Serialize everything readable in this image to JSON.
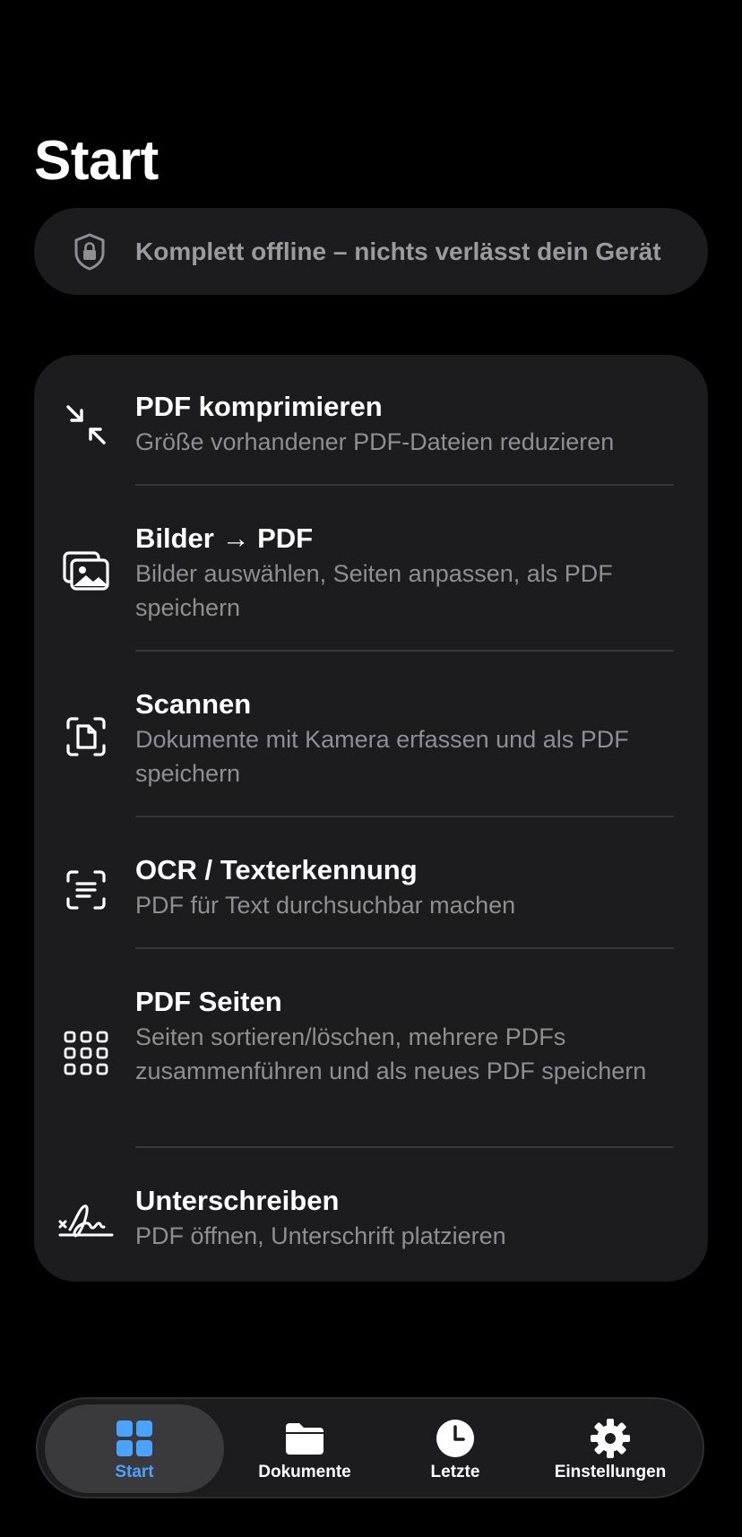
{
  "page": {
    "title": "Start"
  },
  "banner": {
    "icon": "shield-lock-icon",
    "text": "Komplett offline – nichts verlässt dein Gerät"
  },
  "tools": [
    {
      "icon": "compress-arrows-icon",
      "title": "PDF komprimieren",
      "subtitle": "Größe vorhandener PDF-Dateien reduzieren"
    },
    {
      "icon": "images-icon",
      "title": "Bilder → PDF",
      "subtitle": "Bilder auswählen, Seiten anpassen, als PDF speichern"
    },
    {
      "icon": "document-scan-icon",
      "title": "Scannen",
      "subtitle": "Dokumente mit Kamera erfassen und als PDF speichern"
    },
    {
      "icon": "text-recognition-icon",
      "title": "OCR / Texterkennung",
      "subtitle": "PDF für Text durchsuchbar machen"
    },
    {
      "icon": "grid-pages-icon",
      "title": "PDF Seiten",
      "subtitle": "Seiten sortieren/löschen, mehrere PDFs zusammenführen und als neues PDF speichern"
    },
    {
      "icon": "signature-icon",
      "title": "Unterschreiben",
      "subtitle": "PDF öffnen, Unterschrift platzieren"
    }
  ],
  "tabbar": {
    "active_color": "#4aa3ff",
    "tabs": [
      {
        "label": "Start",
        "icon": "grid-icon",
        "active": true
      },
      {
        "label": "Dokumente",
        "icon": "folder-icon",
        "active": false
      },
      {
        "label": "Letzte",
        "icon": "clock-icon",
        "active": false
      },
      {
        "label": "Einstellungen",
        "icon": "gear-icon",
        "active": false
      }
    ]
  }
}
